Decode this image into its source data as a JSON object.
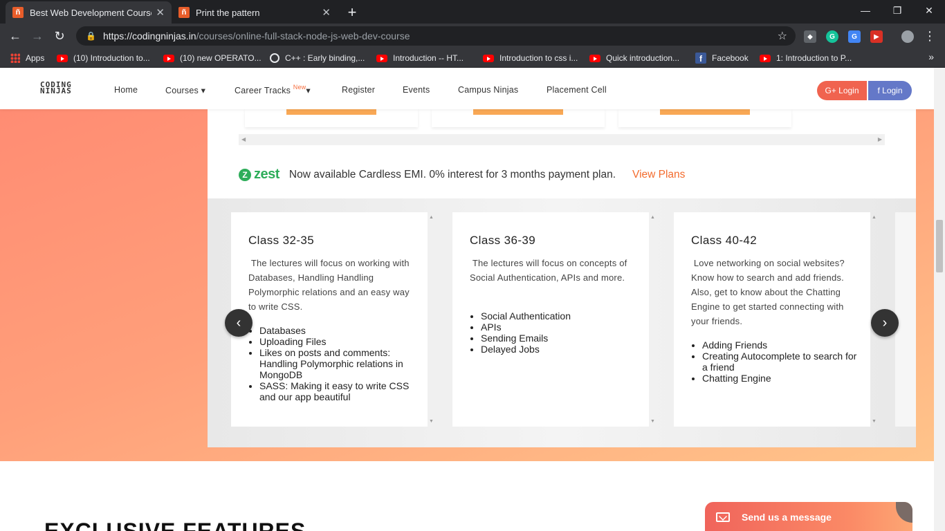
{
  "browser": {
    "tabs": [
      {
        "title": "Best Web Development Course C",
        "active": true
      },
      {
        "title": "Print the pattern",
        "active": false
      }
    ],
    "url_domain": "https://codingninjas.in",
    "url_path": "/courses/online-full-stack-node-js-web-dev-course",
    "bookmarks": [
      {
        "label": "Apps",
        "icon": "apps-icon"
      },
      {
        "label": "(10) Introduction to...",
        "icon": "youtube-icon"
      },
      {
        "label": "(10) new OPERATO...",
        "icon": "youtube-icon"
      },
      {
        "label": "C++ : Early binding,...",
        "icon": "globe-icon"
      },
      {
        "label": "Introduction -- HT...",
        "icon": "youtube-icon"
      },
      {
        "label": "Introduction to css i...",
        "icon": "youtube-icon"
      },
      {
        "label": "Quick introduction...",
        "icon": "youtube-icon"
      },
      {
        "label": "Facebook",
        "icon": "facebook-icon"
      },
      {
        "label": "1: Introduction to P...",
        "icon": "youtube-icon"
      }
    ]
  },
  "site": {
    "logo": {
      "line1": "CODING",
      "line2": "NINJAS"
    },
    "nav": {
      "home": "Home",
      "courses": "Courses",
      "career_tracks": "Career Tracks",
      "new_badge": "New",
      "register": "Register",
      "events": "Events",
      "campus_ninjas": "Campus Ninjas",
      "placement_cell": "Placement Cell",
      "google_login": "G+ Login",
      "facebook_login": "f Login"
    },
    "zest": {
      "brand": "zest",
      "mark": "Z",
      "text": "Now available Cardless EMI. 0% interest for 3 months payment plan.",
      "link": "View Plans"
    },
    "classes": [
      {
        "title": "Class 32-35",
        "desc": " The lectures will focus on working with Databases, Handling Handling Polymorphic relations and an easy way to write CSS.",
        "items": [
          "Databases",
          "Uploading Files",
          "Likes on posts and comments: Handling Polymorphic relations in MongoDB",
          "SASS: Making it easy to write CSS and our app beautiful"
        ]
      },
      {
        "title": "Class 36-39",
        "desc": " The lectures will focus on concepts of Social Authentication, APIs and more.",
        "items": [
          "Social Authentication",
          "APIs",
          "Sending Emails",
          "Delayed Jobs"
        ]
      },
      {
        "title": "Class 40-42",
        "desc": " Love networking on social websites? Know how to search and add friends. Also, get to know about the Chatting Engine to get started connecting with your friends.",
        "items": [
          "Adding Friends",
          "Creating Autocomplete to search for a friend",
          "Chatting Engine"
        ]
      }
    ],
    "features_heading": "EXCLUSIVE FEATURES",
    "chat_widget": {
      "label": "Send us a message"
    }
  },
  "colors": {
    "accent": "#f36b2d",
    "zest_green": "#2ead5a",
    "google_btn": "#f0634f",
    "facebook_btn": "#6478c8"
  }
}
